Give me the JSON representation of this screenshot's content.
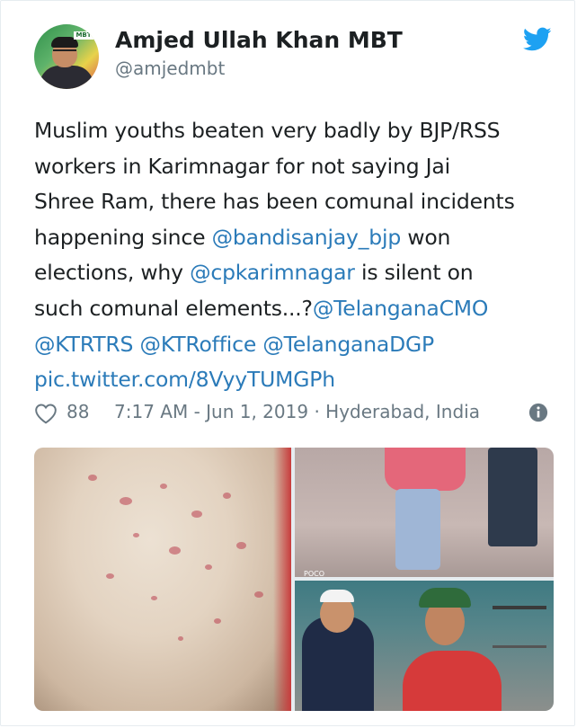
{
  "author": {
    "display_name": "Amjed Ullah Khan MBT",
    "handle": "@amjedmbt",
    "avatar_tag": "MBT"
  },
  "tweet": {
    "lines": [
      [
        {
          "t": "Muslim youths beaten very badly by BJP/RSS",
          "link": false
        }
      ],
      [
        {
          "t": "workers in Karimnagar for not saying Jai",
          "link": false
        }
      ],
      [
        {
          "t": "Shree Ram, there has been comunal incidents",
          "link": false
        }
      ],
      [
        {
          "t": "happening since ",
          "link": false
        },
        {
          "t": "@bandisanjay_bjp",
          "link": true
        },
        {
          "t": " won",
          "link": false
        }
      ],
      [
        {
          "t": "elections, why ",
          "link": false
        },
        {
          "t": "@cpkarimnagar",
          "link": true
        },
        {
          "t": " is silent on",
          "link": false
        }
      ],
      [
        {
          "t": "such comunal elements...?",
          "link": false
        },
        {
          "t": "@TelanganaCMO",
          "link": true
        }
      ],
      [
        {
          "t": "@KTRTRS",
          "link": true
        },
        {
          "t": " ",
          "link": false
        },
        {
          "t": "@KTRoffice",
          "link": true
        },
        {
          "t": " ",
          "link": false
        },
        {
          "t": "@TelanganaDGP",
          "link": true
        }
      ],
      [
        {
          "t": "pic.twitter.com/8VyyTUMGPh",
          "link": true
        }
      ]
    ]
  },
  "meta": {
    "likes": "88",
    "timestamp_location": "7:17 AM - Jun 1, 2019 · Hyderabad, India"
  },
  "media": {
    "photo_stamp": "POCO"
  },
  "colors": {
    "text": "#1c2022",
    "secondary": "#697882",
    "link": "#2b7bb9",
    "twitter_blue": "#1da1f2"
  },
  "icons": {
    "heart": "heart-icon",
    "bird": "twitter-bird-icon",
    "info": "info-icon"
  }
}
